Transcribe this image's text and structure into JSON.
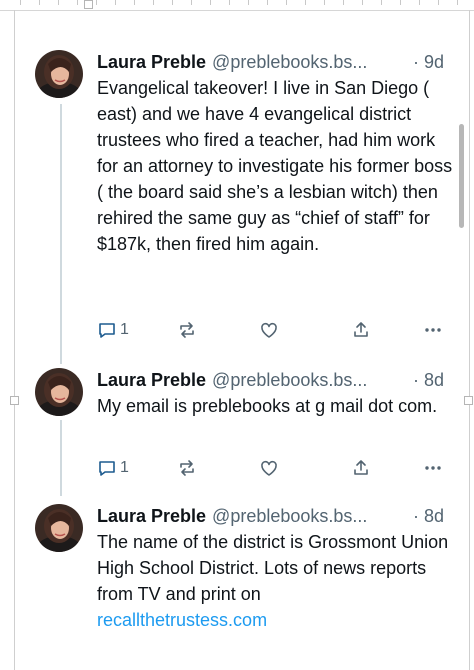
{
  "colors": {
    "text": "#0f1419",
    "muted": "#536471",
    "link": "#1d9bf0",
    "thread_line": "#cfd9de"
  },
  "posts": [
    {
      "name": "Laura Preble",
      "handle": "@preblebooks.bs...",
      "dot": "·",
      "time": "9d",
      "text": "Evangelical takeover! I live in San Diego ( east) and we have 4 evangelical district trustees who fired a teacher, had him work for an attorney to investigate his former boss ( the board said she’s a lesbian witch) then rehired the same guy as “chief of staff” for $187k, then fired him again.",
      "link": "",
      "reply_count": "1",
      "icons": [
        "reply-icon",
        "repost-icon",
        "like-icon",
        "share-icon",
        "more-icon"
      ]
    },
    {
      "name": "Laura Preble",
      "handle": "@preblebooks.bs...",
      "dot": "·",
      "time": "8d",
      "text": "My email is preblebooks at g mail dot com.",
      "link": "",
      "reply_count": "1",
      "icons": [
        "reply-icon",
        "repost-icon",
        "like-icon",
        "share-icon",
        "more-icon"
      ]
    },
    {
      "name": "Laura Preble",
      "handle": "@preblebooks.bs...",
      "dot": "·",
      "time": "8d",
      "text": "The name of the district is Grossmont Union High School District. Lots of news reports from TV and print on",
      "link": "recallthetrustess.com",
      "reply_count": "",
      "icons": []
    }
  ]
}
